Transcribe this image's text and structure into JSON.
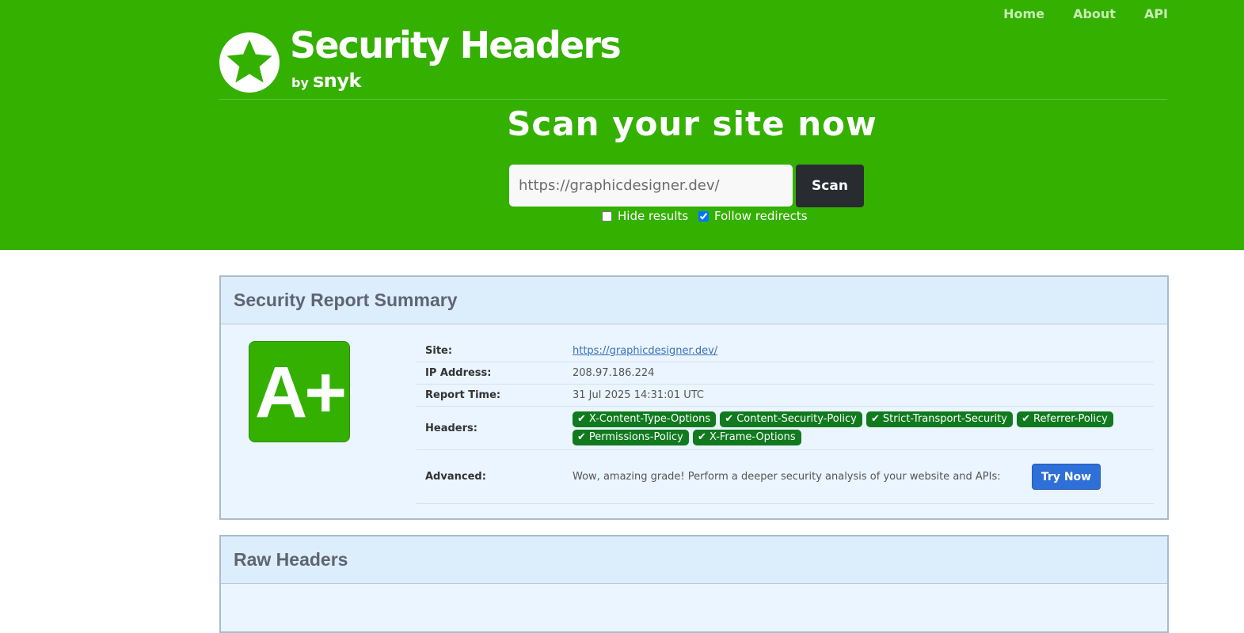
{
  "nav": {
    "home": "Home",
    "about": "About",
    "api": "API"
  },
  "brand": {
    "title": "Security Headers",
    "by": "by",
    "snyk": "snyk",
    "logo_icon": "star-icon"
  },
  "scan": {
    "title": "Scan your site now",
    "url_value": "https://graphicdesigner.dev/",
    "button_label": "Scan",
    "hide_results_label": "Hide results",
    "hide_results_checked": false,
    "follow_redirects_label": "Follow redirects",
    "follow_redirects_checked": true
  },
  "summary": {
    "title": "Security Report Summary",
    "grade": "A+",
    "site_label": "Site:",
    "site_value": "https://graphicdesigner.dev/",
    "ip_label": "IP Address:",
    "ip_value": "208.97.186.224",
    "time_label": "Report Time:",
    "time_value": "31 Jul 2025 14:31:01 UTC",
    "headers_label": "Headers:",
    "headers": [
      "X-Content-Type-Options",
      "Content-Security-Policy",
      "Strict-Transport-Security",
      "Referrer-Policy",
      "Permissions-Policy",
      "X-Frame-Options"
    ],
    "advanced_label": "Advanced:",
    "advanced_text": "Wow, amazing grade! Perform a deeper security analysis of your website and APIs:",
    "try_label": "Try Now"
  },
  "raw": {
    "title": "Raw Headers"
  },
  "colors": {
    "brand_green": "#34b000",
    "pill_green": "#117a1e",
    "button_blue": "#2e6fd8"
  }
}
